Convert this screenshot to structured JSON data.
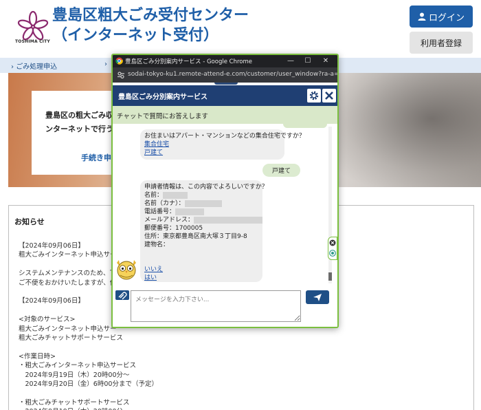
{
  "header": {
    "logo_text": "TOSHIMA CITY",
    "title_line1": "豊島区粗大ごみ受付センター",
    "title_line2": "（インターネット受付）",
    "login_label": "ログイン",
    "register_label": "利用者登録"
  },
  "nav": {
    "items": [
      "ごみ処理申込",
      "›"
    ]
  },
  "hero": {
    "text_line1": "豊島区の粗大ごみ収",
    "text_line2": "ンターネットで行う",
    "link_label": "手続き申込"
  },
  "news": {
    "title": "お知らせ",
    "lines": [
      "【2024年09月06日】",
      "粗大ごみインターネット申込サー",
      "",
      "システムメンテナンスのため、下",
      "ご不便をおかけいたしますが、何",
      "",
      "【2024年09月06日】",
      "",
      "<対象のサービス>",
      "粗大ごみインターネット申込サー",
      "粗大ごみチャットサポートサービス",
      "",
      "<作業日時>",
      "・粗大ごみインターネット申込サービス",
      "　2024年9月19日（木）20時00分～",
      "　2024年9月20日（金）6時00分まで（予定）",
      "",
      "・粗大ごみチャットサポートサービス",
      "　2024年9月19日（木）20時00分～"
    ]
  },
  "popup": {
    "window_title": "豊島区ごみ分別案内サービス - Google Chrome",
    "url": "sodai-tokyo-ku1.remote-attend-e.com/customer/user_window?ra-a=...",
    "chat_title": "豊島区ごみ分別案内サービス",
    "subheader": "チャットで質問にお答えします",
    "message1": {
      "question": "お住まいはアパート・マンションなどの集合住宅ですか？",
      "option1": "集合住宅",
      "option2": "戸建て"
    },
    "user_reply": "戸建て",
    "message2": {
      "header": "申請者情報は、この内容でよろしいですか？",
      "name_label": "名前：",
      "kana_label": "名前（カナ）：",
      "phone_label": "電話番号：",
      "email_label": "メールアドレス：",
      "postal": "郵便番号：1700005",
      "address": "住所：東京都豊島区南大塚３丁目9-8",
      "building": "建物名：",
      "option_no": "いいえ",
      "option_yes": "はい"
    },
    "input_placeholder": "メッセージを入力下さい..."
  },
  "colors": {
    "brand_blue": "#1f5fa8",
    "chat_header": "#1f3f73",
    "chat_green": "#d9e8c9",
    "popup_border": "#7bbf3f"
  }
}
